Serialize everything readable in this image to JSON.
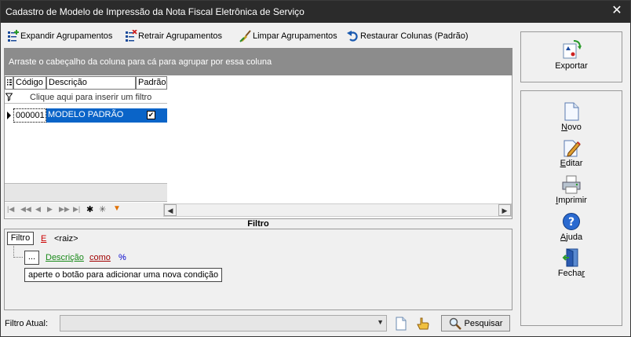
{
  "window": {
    "title": "Cadastro de Modelo de Impressão da Nota Fiscal Eletrônica de Serviço",
    "close_glyph": "✕"
  },
  "toolbar": {
    "expand": "Expandir Agrupamentos",
    "collapse": "Retrair Agrupamentos",
    "clear": "Limpar Agrupamentos",
    "restore": "Restaurar Colunas (Padrão)"
  },
  "groupbar": {
    "hint": "Arraste o cabeçalho da coluna para cá para agrupar por essa coluna"
  },
  "grid": {
    "columns": [
      "Código",
      "Descrição",
      "Padrão"
    ],
    "filter_placeholder": "Clique aqui para inserir um filtro",
    "rows": [
      {
        "codigo": "000001",
        "descricao": "MODELO PADRÃO NFS",
        "padrao": true
      }
    ],
    "check_glyph": "✔"
  },
  "filter": {
    "title": "Filtro",
    "button": "Filtro",
    "op": "E",
    "root": "<raiz>",
    "add": "...",
    "field": "Descrição",
    "operator": "como",
    "value": "%",
    "hint": "aperte o botão para adicionar uma nova condição"
  },
  "bottom": {
    "label": "Filtro Atual:",
    "combo_value": "",
    "search": "Pesquisar"
  },
  "actions": {
    "exportar": "Exportar",
    "novo_u": "N",
    "novo_r": "ovo",
    "editar_u": "E",
    "editar_r": "ditar",
    "imprimir_u": "I",
    "imprimir_r": "mprimir",
    "ajuda_u": "A",
    "ajuda_r": "juda",
    "fechar_pre": "Fecha",
    "fechar_u": "r"
  },
  "colors": {
    "selection": "#0a64c8",
    "titlebar": "#2b2b2b",
    "groupbar": "#8c8c8c"
  }
}
